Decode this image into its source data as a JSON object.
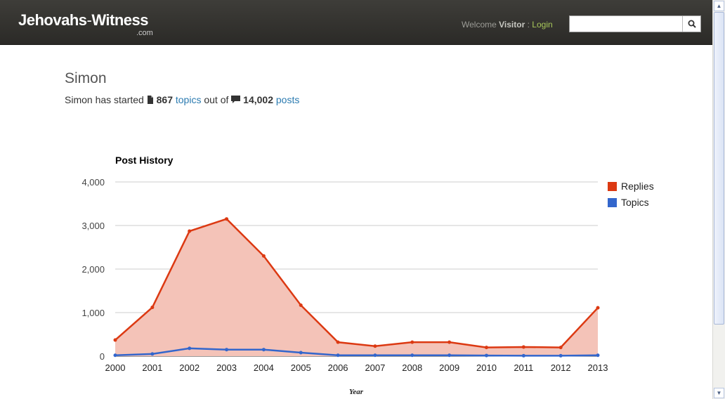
{
  "header": {
    "logo_main": "Jehovahs",
    "logo_dash": "-",
    "logo_second": "Witness",
    "logo_sub": ".com",
    "welcome_text": "Welcome",
    "visitor_text": "Visitor",
    "separator": ":",
    "login_text": "Login",
    "search_value": "",
    "search_icon": "search-icon"
  },
  "profile": {
    "name": "Simon",
    "started_text": "Simon has started",
    "topics_count": "867",
    "topics_link": "topics",
    "out_of_text": "out of",
    "posts_count": "14,002",
    "posts_link": "posts"
  },
  "chart_data": {
    "type": "area",
    "title": "Post History",
    "xlabel": "Year",
    "ylabel": "",
    "x": [
      "2000",
      "2001",
      "2002",
      "2003",
      "2004",
      "2005",
      "2006",
      "2007",
      "2008",
      "2009",
      "2010",
      "2011",
      "2012",
      "2013"
    ],
    "ylim": [
      0,
      4000
    ],
    "yticks": [
      0,
      1000,
      2000,
      3000,
      4000
    ],
    "ytick_labels": [
      "0",
      "1,000",
      "2,000",
      "3,000",
      "4,000"
    ],
    "grid": true,
    "legend_position": "right",
    "series": [
      {
        "name": "Replies",
        "color": "#dc3912",
        "fill": "#f4c3b8",
        "values": [
          370,
          1120,
          2870,
          3150,
          2300,
          1170,
          320,
          230,
          320,
          320,
          200,
          210,
          200,
          1110
        ]
      },
      {
        "name": "Topics",
        "color": "#3366cc",
        "values": [
          20,
          50,
          180,
          150,
          150,
          80,
          20,
          20,
          20,
          20,
          15,
          10,
          10,
          20
        ]
      }
    ]
  }
}
